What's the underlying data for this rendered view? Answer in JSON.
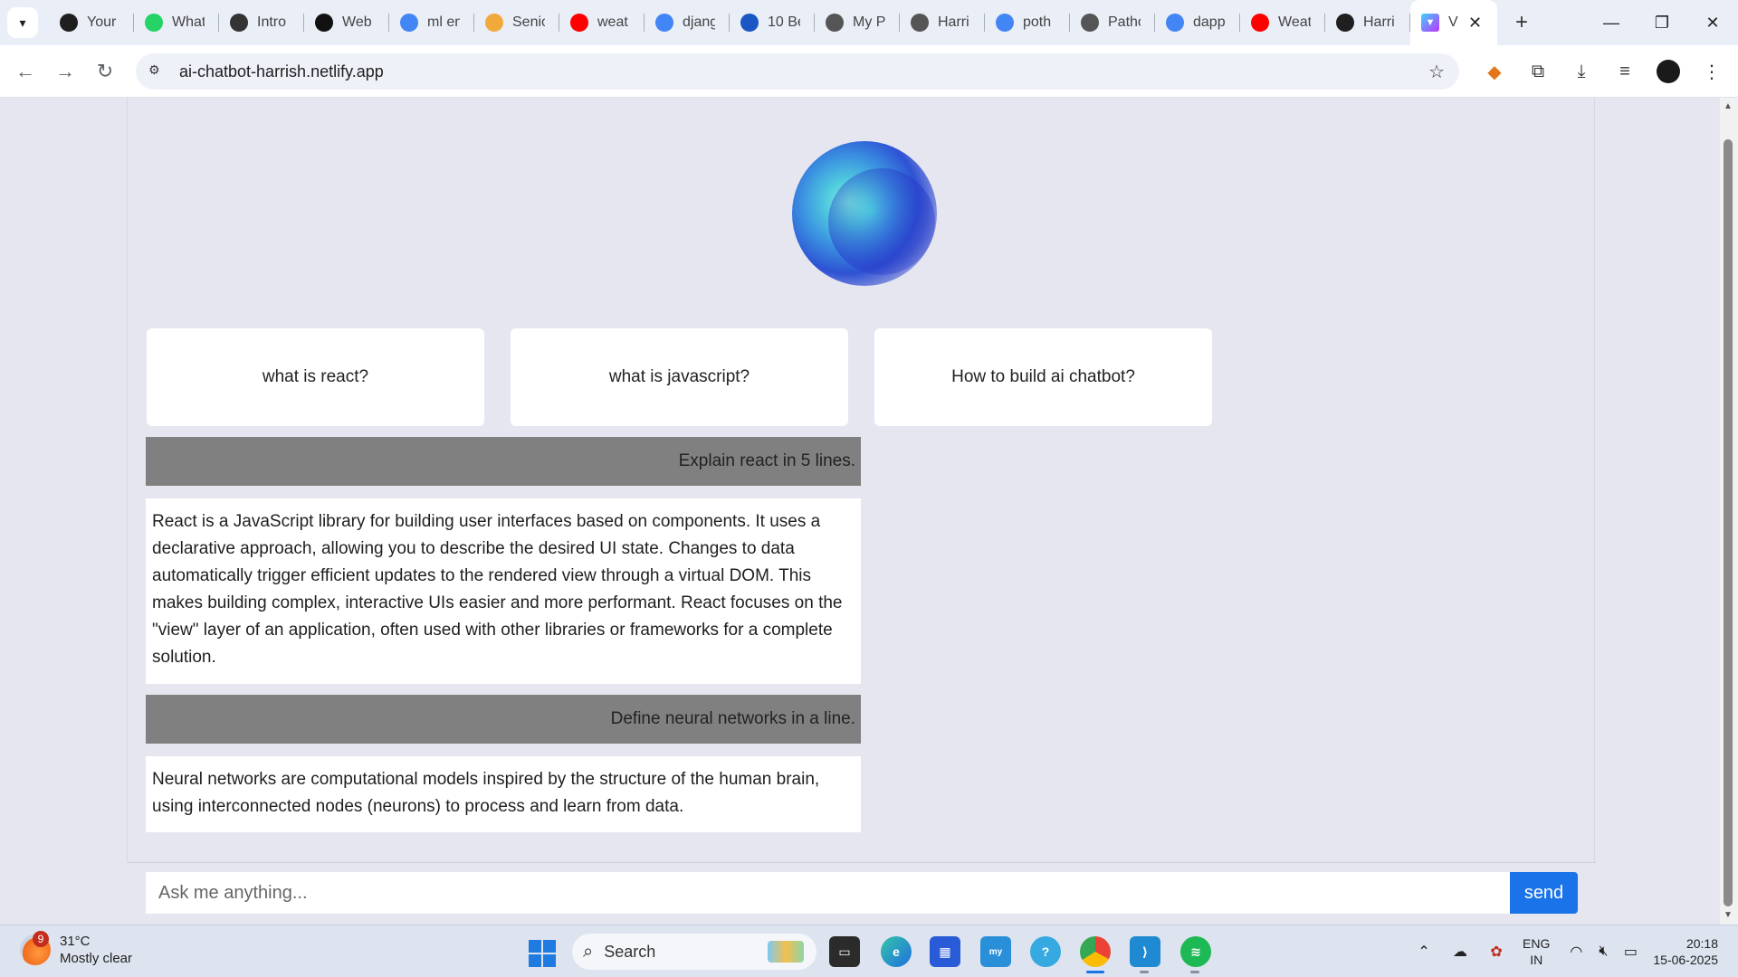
{
  "browser": {
    "tabs": [
      {
        "title": "Your",
        "icon": "github-icon",
        "color": "#1f1f1f"
      },
      {
        "title": "What",
        "icon": "whatsapp-icon",
        "color": "#25d366"
      },
      {
        "title": "Intro",
        "icon": "openai-icon",
        "color": "#333333"
      },
      {
        "title": "Web",
        "icon": "openai-icon",
        "color": "#111111"
      },
      {
        "title": "ml en",
        "icon": "google-icon",
        "color": "#4285f4"
      },
      {
        "title": "Senio",
        "icon": "r-icon",
        "color": "#f2a93b"
      },
      {
        "title": "weat",
        "icon": "youtube-icon",
        "color": "#ff0000"
      },
      {
        "title": "djang",
        "icon": "google-icon",
        "color": "#4285f4"
      },
      {
        "title": "10 Be",
        "icon": "drive-icon",
        "color": "#1a56c4"
      },
      {
        "title": "My P",
        "icon": "globe-icon",
        "color": "#555555"
      },
      {
        "title": "Harri",
        "icon": "globe-icon",
        "color": "#555555"
      },
      {
        "title": "poth",
        "icon": "google-icon",
        "color": "#4285f4"
      },
      {
        "title": "Patho",
        "icon": "globe-icon",
        "color": "#555555"
      },
      {
        "title": "dapp",
        "icon": "google-icon",
        "color": "#4285f4"
      },
      {
        "title": "Weat",
        "icon": "youtube-icon",
        "color": "#ff0000"
      },
      {
        "title": "Harri",
        "icon": "github-icon",
        "color": "#1f1f1f"
      }
    ],
    "active_tab": {
      "title": "V",
      "icon": "vite-icon"
    },
    "url": "ai-chatbot-harrish.netlify.app"
  },
  "chat": {
    "suggestions": [
      "what is react?",
      "what is javascript?",
      "How to build ai chatbot?"
    ],
    "messages": [
      {
        "role": "user",
        "text": "Explain react in 5 lines."
      },
      {
        "role": "bot",
        "text": "React is a JavaScript library for building user interfaces based on components. It uses a declarative approach, allowing you to describe the desired UI state. Changes to data automatically trigger efficient updates to the rendered view through a virtual DOM. This makes building complex, interactive UIs easier and more performant. React focuses on the \"view\" layer of an application, often used with other libraries or frameworks for a complete solution."
      },
      {
        "role": "user",
        "text": "Define neural networks in a line."
      },
      {
        "role": "bot",
        "text": "Neural networks are computational models inspired by the structure of the human brain, using interconnected nodes (neurons) to process and learn from data."
      }
    ],
    "input_placeholder": "Ask me anything...",
    "send_label": "send",
    "accent_color": "#1a73e8",
    "user_bubble_color": "#808080"
  },
  "taskbar": {
    "weather_temp": "31°C",
    "weather_desc": "Mostly clear",
    "weather_badge": "9",
    "search_label": "Search",
    "lang_top": "ENG",
    "lang_bottom": "IN",
    "time": "20:18",
    "date": "15-06-2025"
  }
}
